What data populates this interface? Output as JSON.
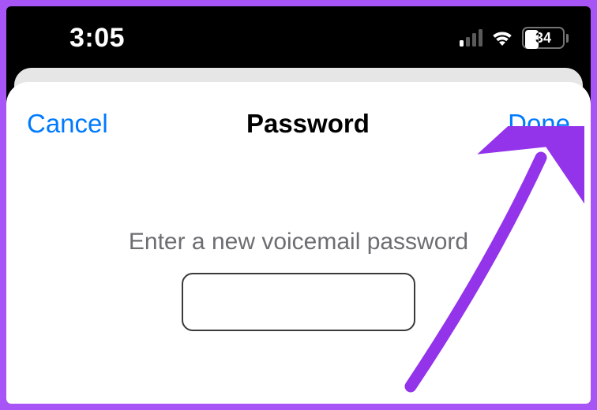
{
  "status_bar": {
    "time": "3:05",
    "battery_percent": "34"
  },
  "sheet": {
    "cancel_label": "Cancel",
    "title": "Password",
    "done_label": "Done",
    "prompt": "Enter a new voicemail password",
    "password_value": ""
  },
  "annotation": {
    "target": "done-button",
    "kind": "arrow",
    "color": "#9333ea"
  }
}
